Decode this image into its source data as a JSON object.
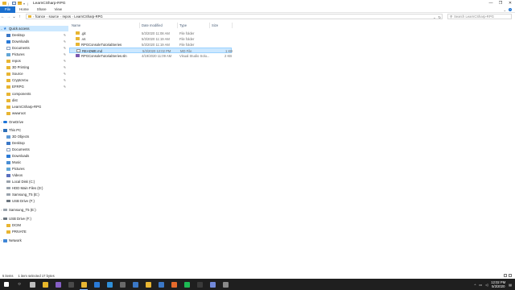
{
  "window": {
    "title": "LearnCSharp-RPG",
    "controls": [
      "—",
      "❐",
      "✕"
    ]
  },
  "ribbon": {
    "tabs": [
      "File",
      "Home",
      "Share",
      "View"
    ]
  },
  "address": {
    "crumbs": [
      "fcance",
      "source",
      "repos",
      "LearnCSharp-RPG"
    ],
    "search_placeholder": "Search LearnCSharp-RPG"
  },
  "sidebar": {
    "quick_access_label": "Quick access",
    "quick_items": [
      {
        "label": "Desktop",
        "icon": "desktop-icon",
        "pinned": true
      },
      {
        "label": "Downloads",
        "icon": "downloads-icon",
        "pinned": true
      },
      {
        "label": "Documents",
        "icon": "documents-icon",
        "pinned": true
      },
      {
        "label": "Pictures",
        "icon": "pictures-icon",
        "pinned": true
      },
      {
        "label": "repos",
        "icon": "folder-icon",
        "pinned": true
      },
      {
        "label": "3D Printing",
        "icon": "folder-icon",
        "pinned": true
      },
      {
        "label": "Source",
        "icon": "folder-icon",
        "pinned": true
      },
      {
        "label": "CryptoVou",
        "icon": "folder-icon",
        "pinned": true
      },
      {
        "label": "EFRPG",
        "icon": "folder-icon",
        "pinned": true
      },
      {
        "label": "components",
        "icon": "folder-icon",
        "pinned": false
      },
      {
        "label": "dist",
        "icon": "folder-icon",
        "pinned": false
      },
      {
        "label": "LearnCSharp-RPG",
        "icon": "folder-icon",
        "pinned": false
      },
      {
        "label": "wwwroot",
        "icon": "folder-icon",
        "pinned": false
      }
    ],
    "onedrive_label": "OneDrive",
    "thispc_label": "This PC",
    "pc_items": [
      {
        "label": "3D Objects",
        "icon": "3d-objects-icon"
      },
      {
        "label": "Desktop",
        "icon": "desktop-icon"
      },
      {
        "label": "Documents",
        "icon": "documents-icon"
      },
      {
        "label": "Downloads",
        "icon": "downloads-icon"
      },
      {
        "label": "Music",
        "icon": "music-icon"
      },
      {
        "label": "Pictures",
        "icon": "pictures-icon"
      },
      {
        "label": "Videos",
        "icon": "videos-icon"
      },
      {
        "label": "Local Disk (C:)",
        "icon": "drive-icon"
      },
      {
        "label": "HDD Main Files (D:)",
        "icon": "drive-icon"
      },
      {
        "label": "Samsung_T5 (E:)",
        "icon": "drive-icon"
      },
      {
        "label": "USB Drive (F:)",
        "icon": "usb-drive-icon"
      }
    ],
    "samsung_label": "Samsung_T5 (E:)",
    "usb_label": "USB Drive (F:)",
    "usb_items": [
      {
        "label": "DCIM",
        "icon": "folder-icon"
      },
      {
        "label": "PRIVATE",
        "icon": "folder-icon"
      }
    ],
    "network_label": "Network"
  },
  "files": {
    "columns": [
      "Name",
      "Date modified",
      "Type",
      "Size"
    ],
    "rows": [
      {
        "name": ".git",
        "date": "5/3/2020 11:08 AM",
        "type": "File folder",
        "size": "",
        "icon": "folder-icon"
      },
      {
        "name": ".vs",
        "date": "5/3/2020 11:19 AM",
        "type": "File folder",
        "size": "",
        "icon": "folder-icon"
      },
      {
        "name": "RPGConsoleTutorialSeries",
        "date": "5/3/2020 11:19 AM",
        "type": "File folder",
        "size": "",
        "icon": "folder-icon"
      },
      {
        "name": "README.md",
        "date": "5/3/2020 12:02 PM",
        "type": "MD File",
        "size": "1 KB",
        "icon": "markdown-file-icon",
        "selected": true
      },
      {
        "name": "RPGConsoleTutorialSeries.sln",
        "date": "4/19/2020 11:09 AM",
        "type": "Visual Studio Solu...",
        "size": "2 KB",
        "icon": "visual-studio-solution-icon"
      }
    ]
  },
  "status": {
    "items": "5 items",
    "selected": "1 item selected 17 bytes"
  },
  "taskbar": {
    "time": "12:02 PM",
    "date": "5/3/2020",
    "apps": [
      {
        "icon": "start-icon",
        "color": "#ffffff"
      },
      {
        "icon": "search-icon",
        "color": "#ffffff"
      },
      {
        "icon": "task-view-icon",
        "color": "#bfbfbf"
      },
      {
        "icon": "chrome-icon",
        "color": "#e9b72a"
      },
      {
        "icon": "visual-studio-icon",
        "color": "#865fc5"
      },
      {
        "icon": "terminal-icon",
        "color": "#4a4a4a"
      },
      {
        "icon": "file-explorer-icon",
        "color": "#e8b532",
        "active": true
      },
      {
        "icon": "mail-icon",
        "color": "#2a7ad7"
      },
      {
        "icon": "edge-icon",
        "color": "#2f8fd8"
      },
      {
        "icon": "calculator-icon",
        "color": "#6a6a6a"
      },
      {
        "icon": "store-icon",
        "color": "#3b78c7"
      },
      {
        "icon": "notes-icon",
        "color": "#e8b532"
      },
      {
        "icon": "photos-icon",
        "color": "#3b78c7"
      },
      {
        "icon": "firefox-icon",
        "color": "#e66a2b"
      },
      {
        "icon": "spotify-icon",
        "color": "#1db954"
      },
      {
        "icon": "obs-icon",
        "color": "#3a3a3a"
      },
      {
        "icon": "discord-icon",
        "color": "#7289da"
      },
      {
        "icon": "settings-icon",
        "color": "#8a8a8a"
      }
    ]
  },
  "colors": {
    "accent": "#1a6fcf",
    "selection": "#cce8ff",
    "folder": "#e8b532",
    "taskbar": "#1f1f1f"
  }
}
